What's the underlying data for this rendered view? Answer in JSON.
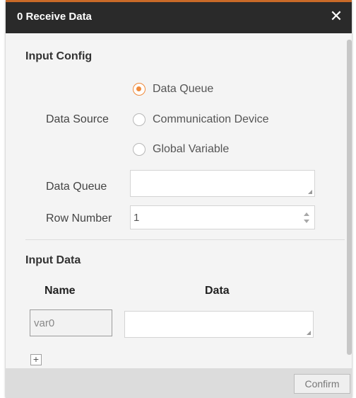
{
  "dialog": {
    "title": "0 Receive Data",
    "close_glyph": "✕"
  },
  "input_config": {
    "section_title": "Input Config",
    "data_source_label": "Data Source",
    "data_source_options": [
      "Data Queue",
      "Communication Device",
      "Global Variable"
    ],
    "data_source_selected": "Data Queue",
    "data_queue_label": "Data Queue",
    "data_queue_value": "",
    "row_number_label": "Row Number",
    "row_number_value": "1"
  },
  "input_data": {
    "section_title": "Input Data",
    "columns": [
      "Name",
      "Data"
    ],
    "rows": [
      {
        "name": "var0",
        "data": ""
      }
    ],
    "add_glyph": "+"
  },
  "footer": {
    "confirm_label": "Confirm"
  },
  "colors": {
    "title_bar": "#2a2a2a",
    "accent": "#f08a3a",
    "panel_bg": "#f4f4f4"
  }
}
